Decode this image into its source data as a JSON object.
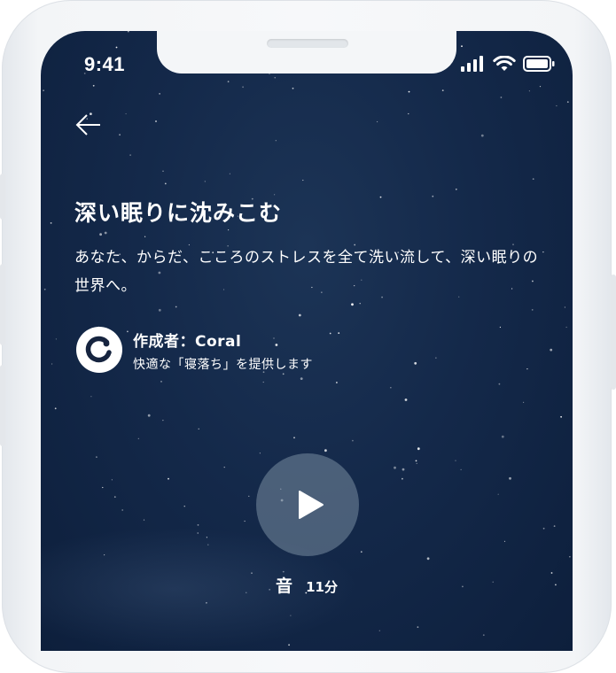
{
  "status_bar": {
    "time": "9:41",
    "icons": [
      "signal-icon",
      "wifi-icon",
      "battery-icon"
    ]
  },
  "nav": {
    "back_icon": "back-arrow-icon"
  },
  "content": {
    "title": "深い眠りに沈みこむ",
    "description": "あなた、からだ、こころのストレスを全て洗い流して、深い眠りの世界へ。",
    "creator": {
      "name": "作成者：Coral",
      "tagline": "快適な「寝落ち」を提供します",
      "logo_icon": "coral-logo-icon"
    }
  },
  "player": {
    "play_icon": "play-icon",
    "type_label": "音",
    "duration_label": "11分"
  },
  "colors": {
    "background_top": "#1c3456",
    "background_bottom": "#0d1f3c",
    "text": "#ffffff",
    "play_button_fill": "#788ca0",
    "frame": "#f3f5f7"
  }
}
